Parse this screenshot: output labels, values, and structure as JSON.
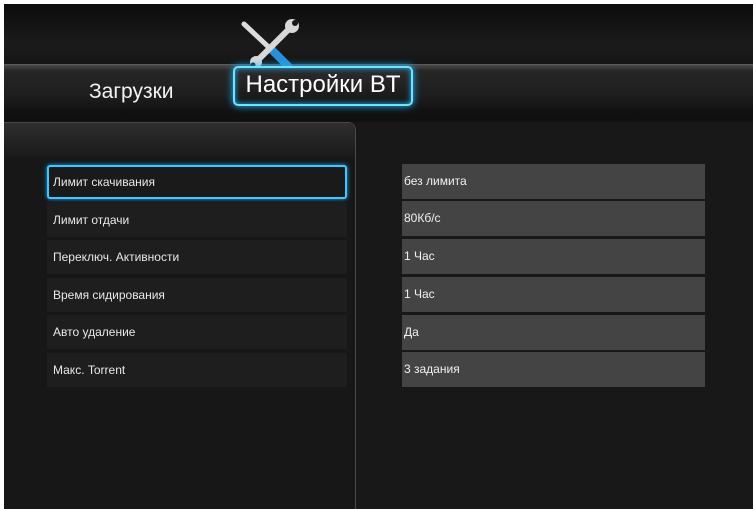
{
  "tabs": [
    {
      "label": "Загрузки",
      "active": false
    },
    {
      "label": "Настройки BT",
      "active": true
    }
  ],
  "header": {
    "active_tab_icon": "tools-icon"
  },
  "settings": [
    {
      "label": "Лимит скачивания",
      "value": "без лимита",
      "selected": true
    },
    {
      "label": "Лимит отдачи",
      "value": "80Кб/с",
      "selected": false
    },
    {
      "label": "Переключ. Активности",
      "value": "1 Час",
      "selected": false
    },
    {
      "label": "Время сидирования",
      "value": "1 Час",
      "selected": false
    },
    {
      "label": "Авто удаление",
      "value": "Да",
      "selected": false
    },
    {
      "label": "Макс. Torrent",
      "value": "3 задания",
      "selected": false
    }
  ],
  "colors": {
    "background": "#181818",
    "highlight": "#3ec7ff",
    "value_cell": "#444444"
  }
}
